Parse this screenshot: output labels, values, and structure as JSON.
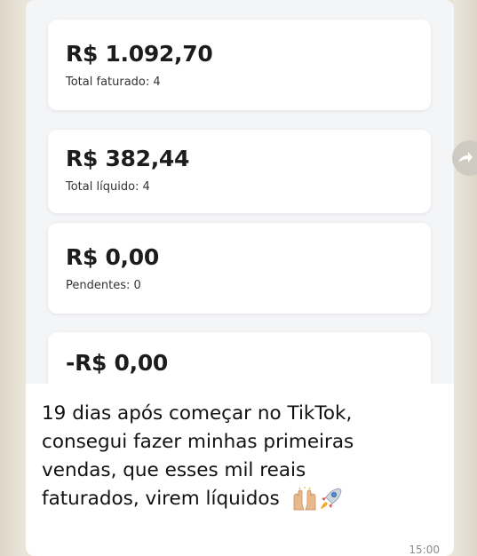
{
  "cards": [
    {
      "amount": "R$ 1.092,70",
      "label": "Total faturado: 4"
    },
    {
      "amount": "R$ 382,44",
      "label": "Total líquido: 4"
    },
    {
      "amount": "R$ 0,00",
      "label": "Pendentes: 0"
    },
    {
      "amount": "-R$ 0,00",
      "label": ""
    }
  ],
  "message": {
    "lines": [
      "19 dias após começar no TikTok,",
      "consegui fazer minhas primeiras",
      "vendas, que esses mil reais",
      "faturados, virem líquidos"
    ],
    "emojis": [
      "raising-hands-icon",
      "rocket-icon"
    ],
    "time": "15:00"
  },
  "colors": {
    "bubble": "#ffffff",
    "wallpaper": "#e9e3d8",
    "card_bg": "#f4f5f7",
    "text": "#111111"
  }
}
